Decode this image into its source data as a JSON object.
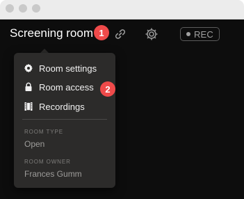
{
  "window": {
    "controls": [
      "close",
      "minimize",
      "zoom"
    ]
  },
  "header": {
    "room_title": "Screening room",
    "badge_1": "1",
    "link_icon": "link-icon",
    "settings_icon": "gear-icon",
    "rec_label": "REC"
  },
  "menu": {
    "items": [
      {
        "label": "Room settings",
        "icon": "gear-icon"
      },
      {
        "label": "Room access",
        "icon": "lock-icon"
      },
      {
        "label": "Recordings",
        "icon": "film-icon"
      }
    ],
    "badge_2": "2",
    "room_type_label": "ROOM TYPE",
    "room_type_value": "Open",
    "room_owner_label": "ROOM OWNER",
    "room_owner_value": "Frances Gumm"
  },
  "colors": {
    "app_bg": "#0d0d0d",
    "menu_bg": "#2c2b2a",
    "badge": "#ef4a4a",
    "muted": "#9a9a9a"
  }
}
